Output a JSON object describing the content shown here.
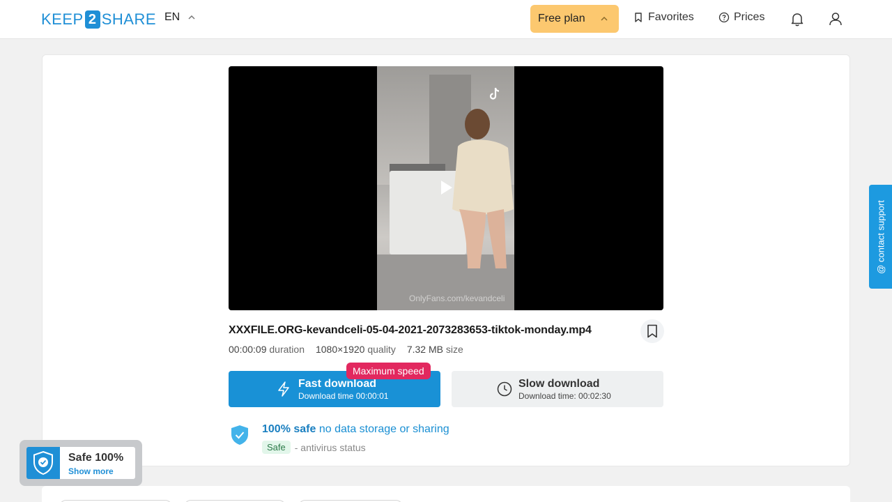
{
  "header": {
    "logo_left": "KEEP",
    "logo_mid": "2",
    "logo_right": "SHARE",
    "language": "EN",
    "plan_label": "Free plan",
    "favorites_label": "Favorites",
    "prices_label": "Prices",
    "icons": [
      "chevron-up-icon",
      "bookmark-icon",
      "question-circle-icon",
      "bell-icon",
      "user-icon"
    ]
  },
  "video": {
    "watermark": "OnlyFans.com/kevandceli",
    "overlay_icon": "tiktok-logo-icon",
    "play_icon": "play-icon"
  },
  "file": {
    "name": "XXXFILE.ORG-kevandceli-05-04-2021-2073283653-tiktok-monday.mp4",
    "duration_value": "00:00:09",
    "duration_label": "duration",
    "quality_value": "1080×1920",
    "quality_label": "quality",
    "size_value": "7.32 MB",
    "size_label": "size"
  },
  "download": {
    "fast_title": "Fast download",
    "fast_sub": "Download time 00:00:01",
    "max_speed_badge": "Maximum speed",
    "slow_title": "Slow download",
    "slow_sub": "Download time: 00:02:30"
  },
  "safety": {
    "safe_bold": "100% safe",
    "safe_rest": "no data storage or sharing",
    "av_pill": "Safe",
    "av_text": "- antivirus status"
  },
  "contact_support": "@ contact support",
  "safe_widget": {
    "title": "Safe 100%",
    "link": "Show more"
  },
  "colors": {
    "brand_blue": "#1991d6",
    "plan_yellow": "#fcc86f",
    "badge_red": "#e2285f",
    "contact_blue": "#1d9ae0"
  }
}
